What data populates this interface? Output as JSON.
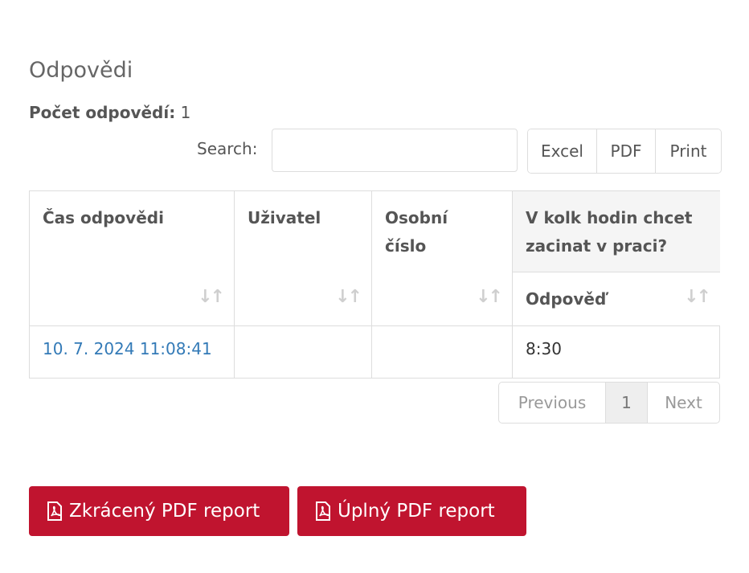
{
  "section": {
    "title": "Odpovědi"
  },
  "summary": {
    "label": "Počet odpovědí:",
    "value": "1"
  },
  "search": {
    "label": "Search:",
    "placeholder": "",
    "value": ""
  },
  "export_buttons": [
    "Excel",
    "PDF",
    "Print"
  ],
  "table": {
    "columns": [
      "Čas odpovědi",
      "Uživatel",
      "Osobní číslo"
    ],
    "question_header": "V kolk hodin chcet zacinat v praci?",
    "answer_subheader": "Odpověď",
    "rows": [
      {
        "time": "10. 7. 2024 11:08:41",
        "user": "",
        "personal_number": "",
        "answer": "8:30"
      }
    ]
  },
  "pagination": {
    "previous": "Previous",
    "current": "1",
    "next": "Next"
  },
  "reports": {
    "short_label": "Zkrácený PDF report",
    "full_label": "Úplný PDF report"
  },
  "icons": {
    "sort": "sort-icon",
    "pdf": "file-pdf-icon"
  },
  "colors": {
    "accent": "#c0142f",
    "link": "#337ab7",
    "header_bg": "#f5f5f5",
    "border": "#dddddd"
  }
}
